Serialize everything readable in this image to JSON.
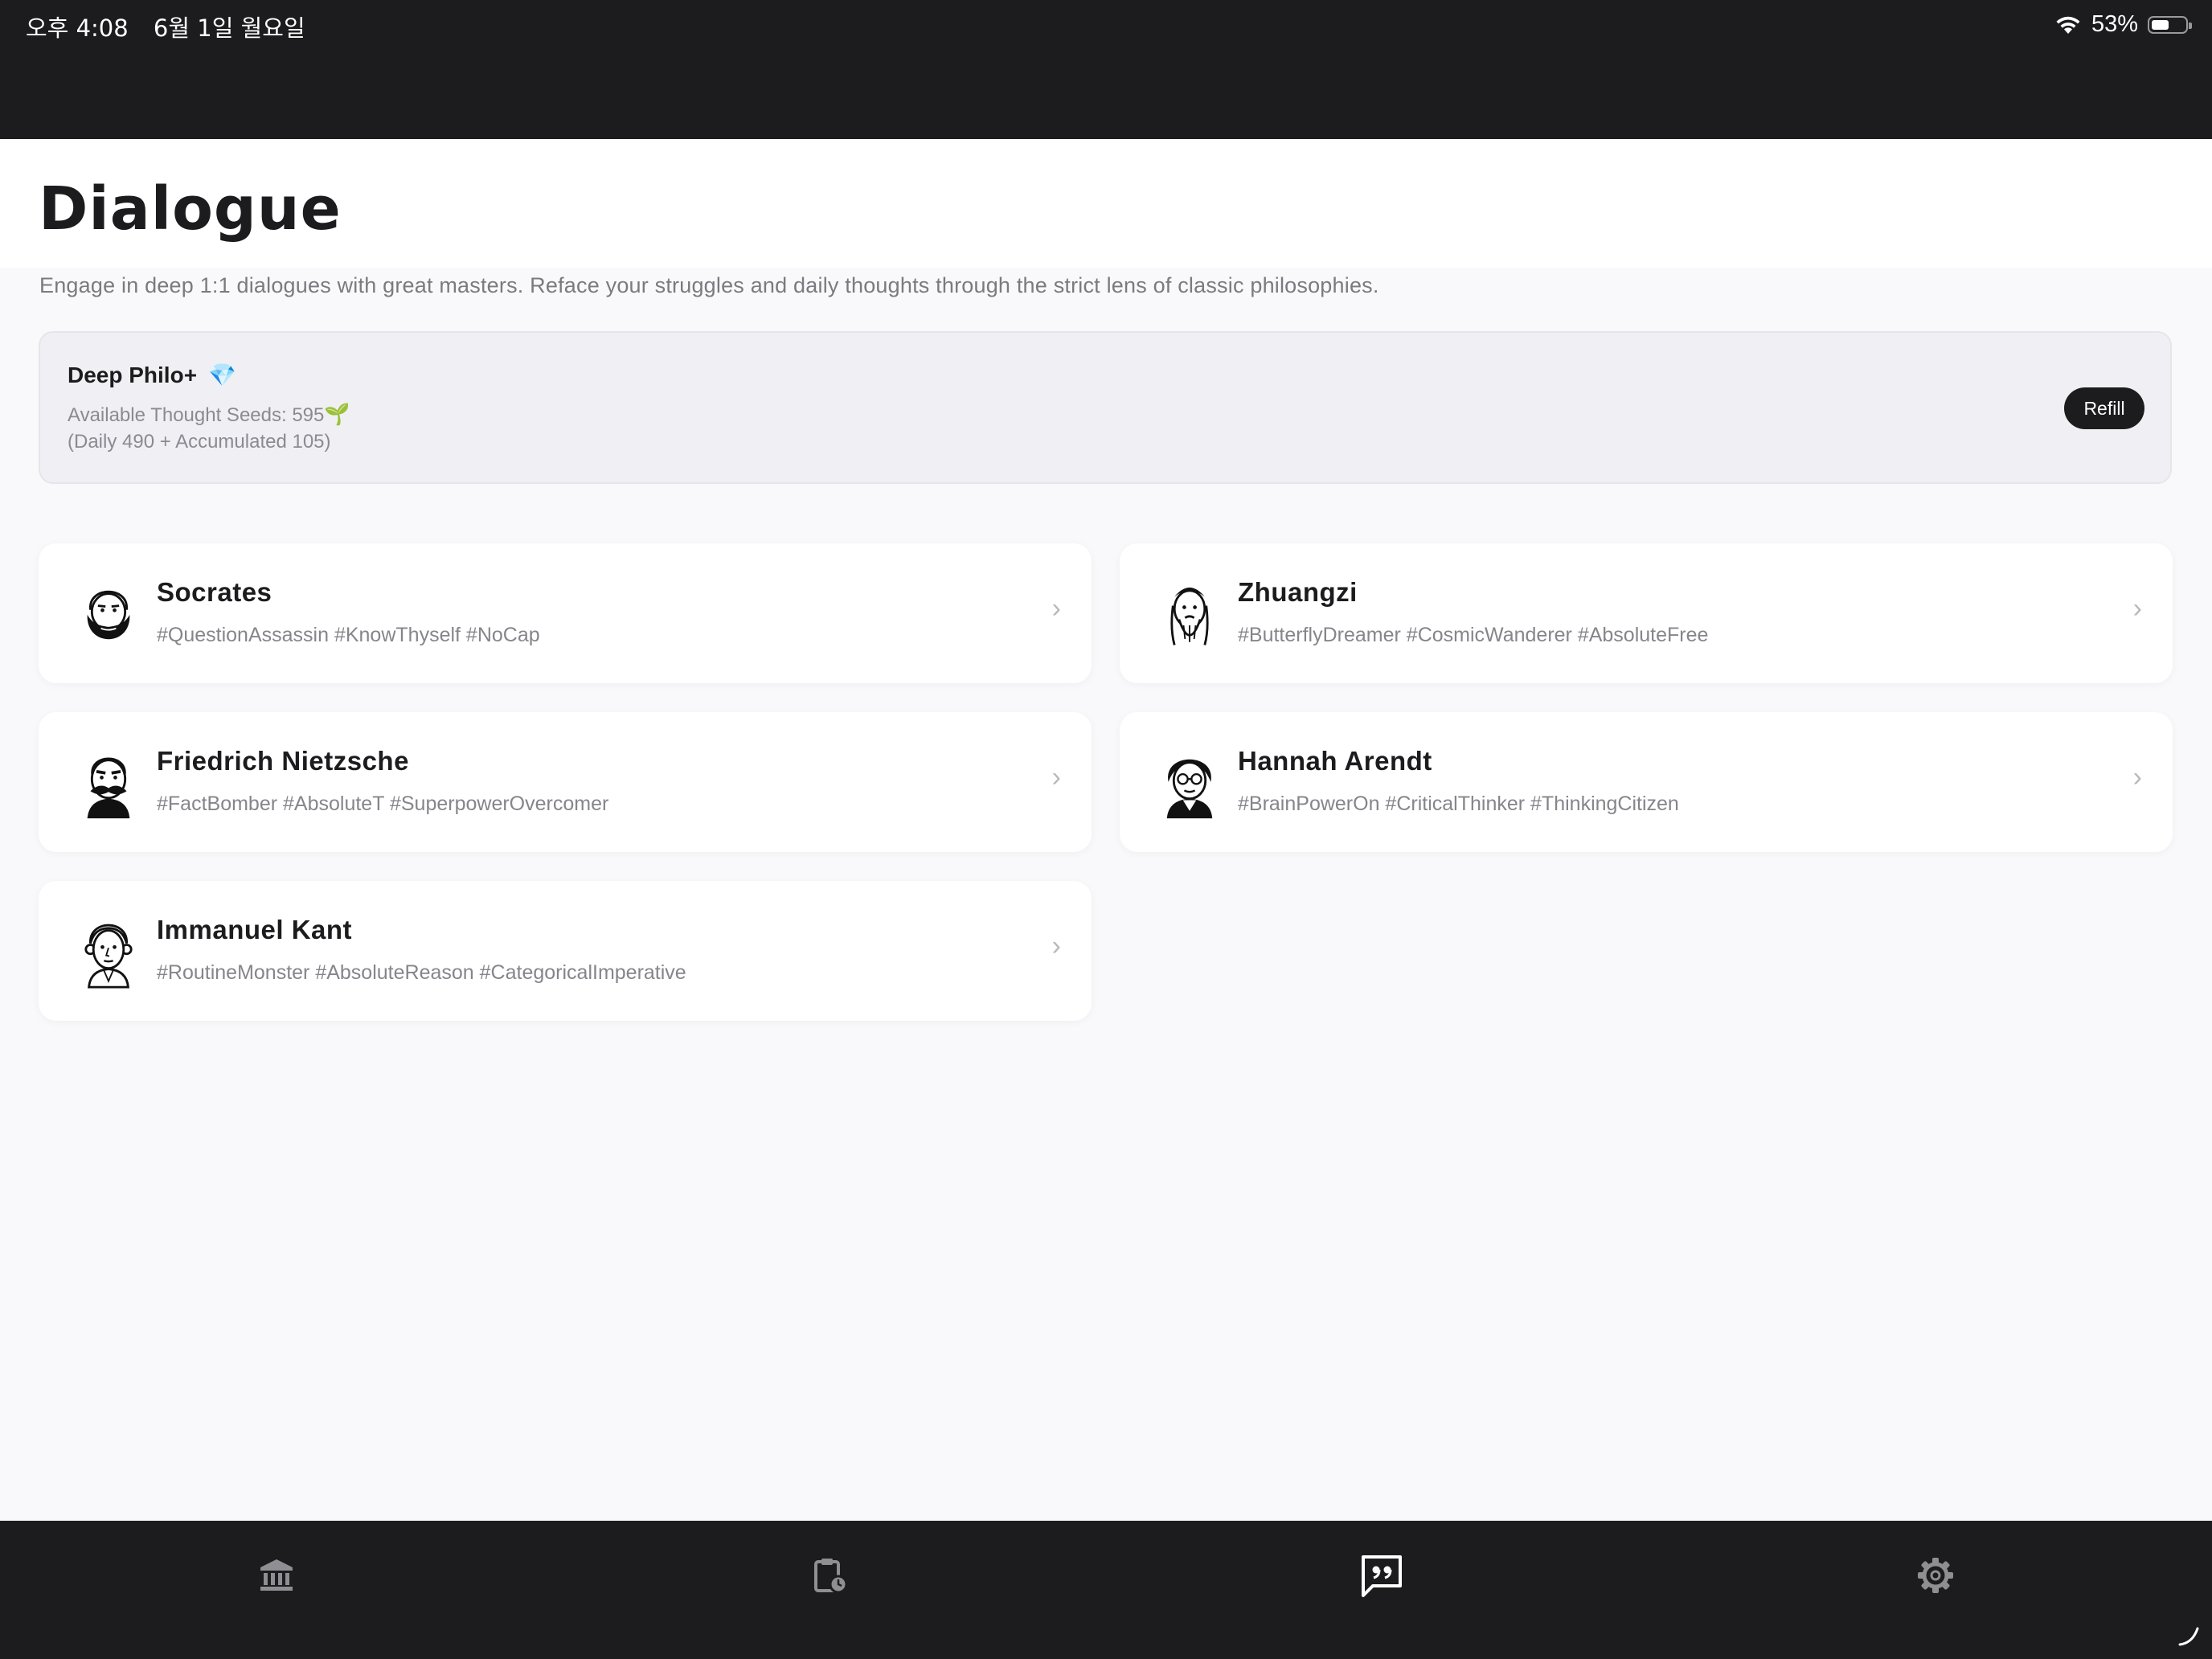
{
  "status_bar": {
    "time": "오후 4:08",
    "date": "6월 1일 월요일",
    "battery_percent": "53%",
    "battery_level": 0.53
  },
  "header": {
    "title": "Dialogue",
    "subtitle": "Engage in deep 1:1 dialogues with great masters. Reface your struggles and daily thoughts through the strict lens of classic philosophies."
  },
  "plan": {
    "name": "Deep Philo+",
    "gem_icon": "💎",
    "seeds_text": "Available Thought Seeds: 595",
    "seed_icon": "🌱",
    "daily_text": "(Daily 490 + Accumulated 105)",
    "refill_label": "Refill"
  },
  "philosophers": [
    {
      "name": "Socrates",
      "tags": "#QuestionAssassin  #KnowThyself  #NoCap",
      "icon": "socrates-portrait-icon"
    },
    {
      "name": "Zhuangzi",
      "tags": "#ButterflyDreamer  #CosmicWanderer  #AbsoluteFree",
      "icon": "zhuangzi-portrait-icon"
    },
    {
      "name": "Friedrich Nietzsche",
      "tags": "#FactBomber  #AbsoluteT  #SuperpowerOvercomer",
      "icon": "nietzsche-portrait-icon"
    },
    {
      "name": "Hannah Arendt",
      "tags": "#BrainPowerOn  #CriticalThinker  #ThinkingCitizen",
      "icon": "arendt-portrait-icon"
    },
    {
      "name": "Immanuel Kant",
      "tags": "#RoutineMonster  #AbsoluteReason  #CategoricalImperative",
      "icon": "kant-portrait-icon"
    }
  ],
  "chevron": "›",
  "tabs": [
    {
      "icon": "museum-icon",
      "active": false
    },
    {
      "icon": "clipboard-clock-icon",
      "active": false
    },
    {
      "icon": "quote-chat-icon",
      "active": true
    },
    {
      "icon": "gear-icon",
      "active": false
    }
  ],
  "colors": {
    "dark": "#1c1c1e",
    "background": "#f9f9fb",
    "muted_text": "#85858b",
    "inactive_tab": "#8e8e93",
    "active_tab": "#ffffff"
  }
}
